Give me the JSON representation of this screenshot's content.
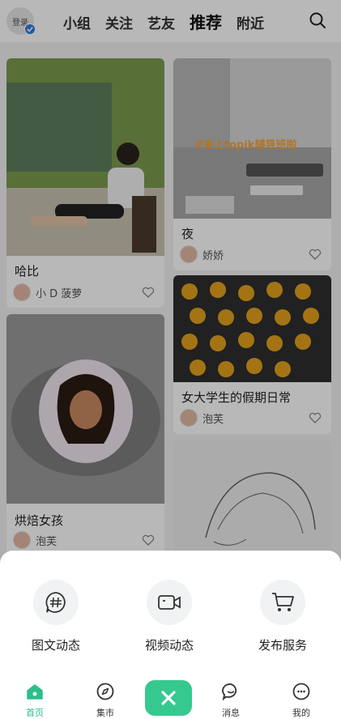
{
  "header": {
    "login_label": "登录",
    "tabs": [
      "小组",
      "关注",
      "艺友",
      "推荐",
      "附近"
    ],
    "active_tab": "推荐"
  },
  "feed": {
    "cards": [
      {
        "title": "哈比",
        "author": "小 D 菠萝"
      },
      {
        "title": "夜",
        "author": "娇娇",
        "image_text": "#来上topik辅导班啦"
      },
      {
        "title": "女大学生的假期日常",
        "author": "泡芙"
      },
      {
        "title": "烘焙女孩",
        "author": "泡芙"
      }
    ]
  },
  "publish_sheet": {
    "actions": [
      {
        "label": "图文动态",
        "icon": "hashtag-icon"
      },
      {
        "label": "视频动态",
        "icon": "video-camera-icon"
      },
      {
        "label": "发布服务",
        "icon": "shopping-cart-icon"
      }
    ]
  },
  "navbar": {
    "items": [
      {
        "label": "首页",
        "icon": "home-icon"
      },
      {
        "label": "集市",
        "icon": "compass-icon"
      },
      {
        "label": "消息",
        "icon": "chat-icon"
      },
      {
        "label": "我的",
        "icon": "profile-icon"
      }
    ],
    "active": "首页"
  },
  "colors": {
    "accent": "#36c98f",
    "active_nav": "#2bbf8a"
  }
}
